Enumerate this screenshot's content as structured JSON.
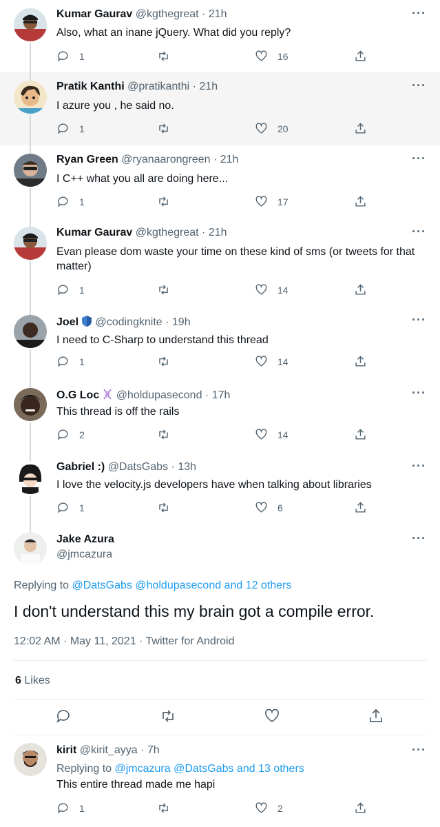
{
  "tweets": [
    {
      "name": "Kumar Gaurav",
      "handle": "@kgthegreat",
      "dot": "·",
      "time": "21h",
      "lines": [
        "Also, what an inane jQuery. What did you reply?"
      ],
      "replies": "1",
      "likes": "16"
    },
    {
      "name": "Pratik Kanthi",
      "handle": "@pratikanthi",
      "dot": "·",
      "time": "21h",
      "lines": [
        "I azure you , he said no."
      ],
      "replies": "1",
      "likes": "20"
    },
    {
      "name": "Ryan Green",
      "handle": "@ryanaarongreen",
      "dot": "·",
      "time": "21h",
      "lines": [
        "I C++ what you all are doing here..."
      ],
      "replies": "1",
      "likes": "17"
    },
    {
      "name": "Kumar Gaurav",
      "handle": "@kgthegreat",
      "dot": "·",
      "time": "21h",
      "lines": [
        "Evan please dom waste your time on these kind of sms (or tweets for that",
        "matter)"
      ],
      "replies": "1",
      "likes": "14"
    },
    {
      "name": "Joel",
      "handle": "@codingknite",
      "dot": "·",
      "time": "19h",
      "lines": [
        "I need to C-Sharp to understand this thread"
      ],
      "replies": "1",
      "likes": "14"
    },
    {
      "name": "O.G Loc",
      "handle": "@holdupasecond",
      "dot": "·",
      "time": "17h",
      "lines": [
        "This thread is off the rails"
      ],
      "replies": "2",
      "likes": "14"
    },
    {
      "name": "Gabriel :)",
      "handle": "@DatsGabs",
      "dot": "·",
      "time": "13h",
      "lines": [
        "I love the velocity.js developers have when talking about libraries"
      ],
      "replies": "1",
      "likes": "6"
    }
  ],
  "focused": {
    "name": "Jake Azura",
    "handle": "@jmcazura",
    "replying_prefix": "Replying to",
    "replying_links": "@DatsGabs @holdupasecond and 12 others",
    "text": "I don't understand this my brain got a compile error.",
    "meta": "12:02 AM · May 11, 2021 · Twitter for Android",
    "likes_count": "6",
    "likes_label": "Likes"
  },
  "reply": {
    "name": "kirit",
    "handle": "@kirit_ayya",
    "dot": "·",
    "time": "7h",
    "replying_prefix": "Replying to",
    "replying_links": "@jmcazura @DatsGabs and 13 others",
    "text": "This entire thread made me hapi",
    "replies": "1",
    "likes": "2"
  },
  "more_glyph": "···",
  "icons": {
    "reply": "reply-icon",
    "retweet": "retweet-icon",
    "like": "heart-icon",
    "share": "share-icon",
    "verified": "shield-badge-icon",
    "dna": "dna-emoji-icon"
  },
  "colors": {
    "link": "#1d9bf0",
    "muted": "#536471",
    "text": "#0f1419",
    "highlight": "#f5f5f5"
  }
}
